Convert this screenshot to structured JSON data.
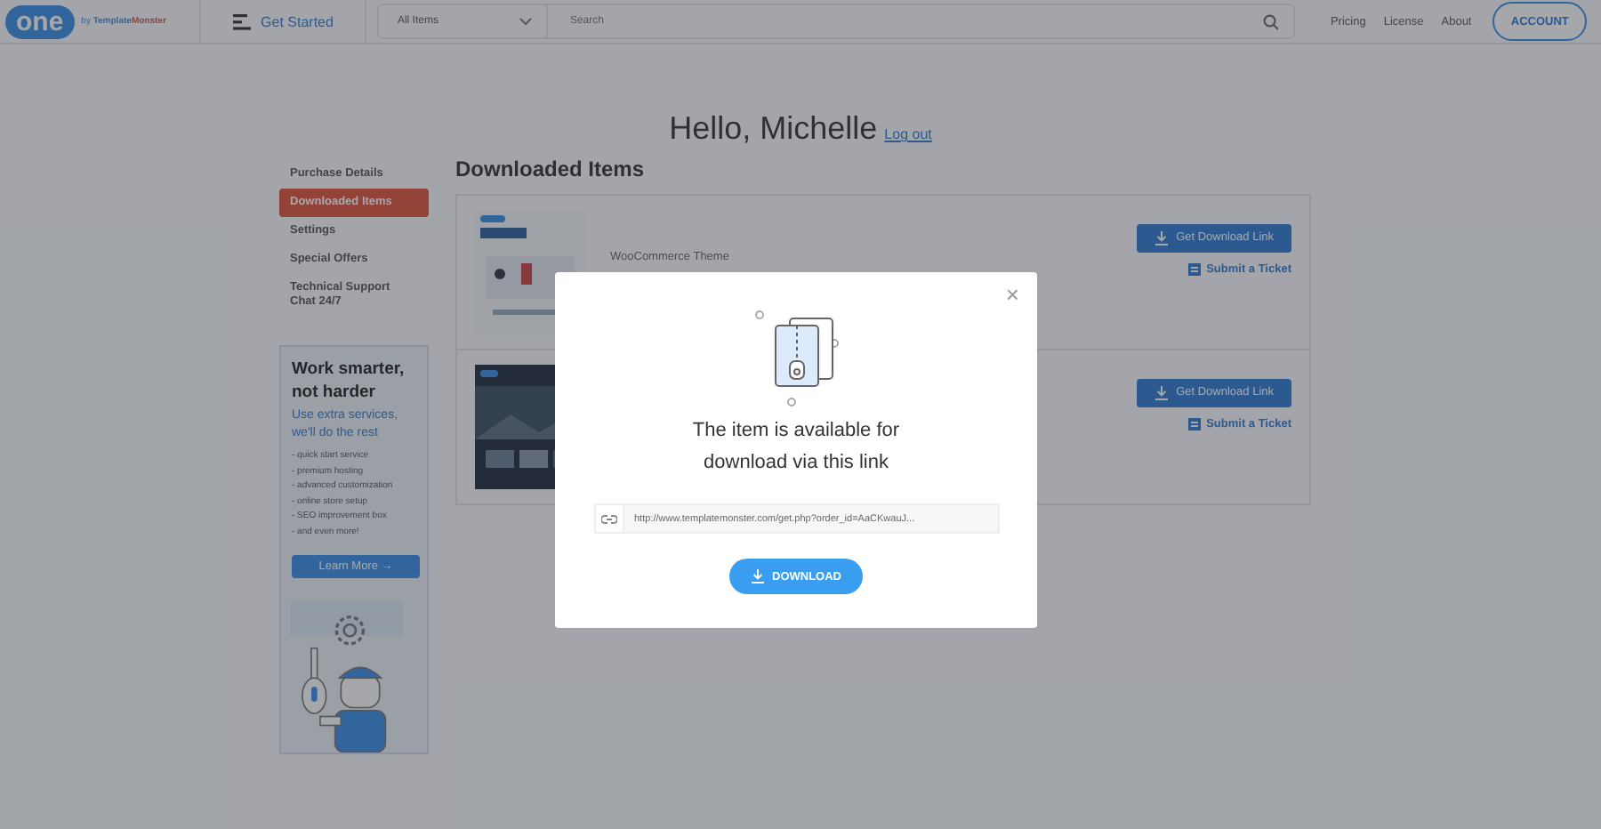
{
  "header": {
    "logo": "one",
    "logo_by": "by",
    "logo_brand_a": "Template",
    "logo_brand_b": "Monster",
    "get_started": "Get Started",
    "category": "All Items",
    "search": {
      "placeholder": "Search"
    },
    "nav": [
      "Pricing",
      "License",
      "About"
    ],
    "account": "ACCOUNT"
  },
  "greeting": {
    "text": "Hello, Michelle",
    "logout": "Log out"
  },
  "sidebar": {
    "items": [
      {
        "label": "Purchase Details",
        "selected": false
      },
      {
        "label": "Downloaded Items",
        "selected": true
      },
      {
        "label": "Settings",
        "selected": false
      },
      {
        "label": "Special Offers",
        "selected": false
      },
      {
        "label": "Technical Support Chat 24/7",
        "selected": false
      }
    ]
  },
  "promo": {
    "title": "Work smarter, not harder",
    "subtitle": "Use extra services, we'll do the rest",
    "list": [
      "- quick start service",
      "- premium hosting",
      "- advanced customization",
      "- online store setup",
      "- SEO improvement box",
      "- and even more!"
    ],
    "button": "Learn More →"
  },
  "main": {
    "title": "Downloaded Items",
    "items": [
      {
        "kind": "picture",
        "description": "WooCommerce Theme",
        "button": "Get Download Link",
        "ticket": "Submit a Ticket"
      },
      {
        "kind": "picture",
        "button": "Get Download Link",
        "ticket": "Submit a Ticket"
      }
    ]
  },
  "modal": {
    "close": "×",
    "message": "The item is available for download via this link",
    "link": "http://www.templatemonster.com/get.php?order_id=AaCKwauJ...",
    "button": "DOWNLOAD"
  }
}
